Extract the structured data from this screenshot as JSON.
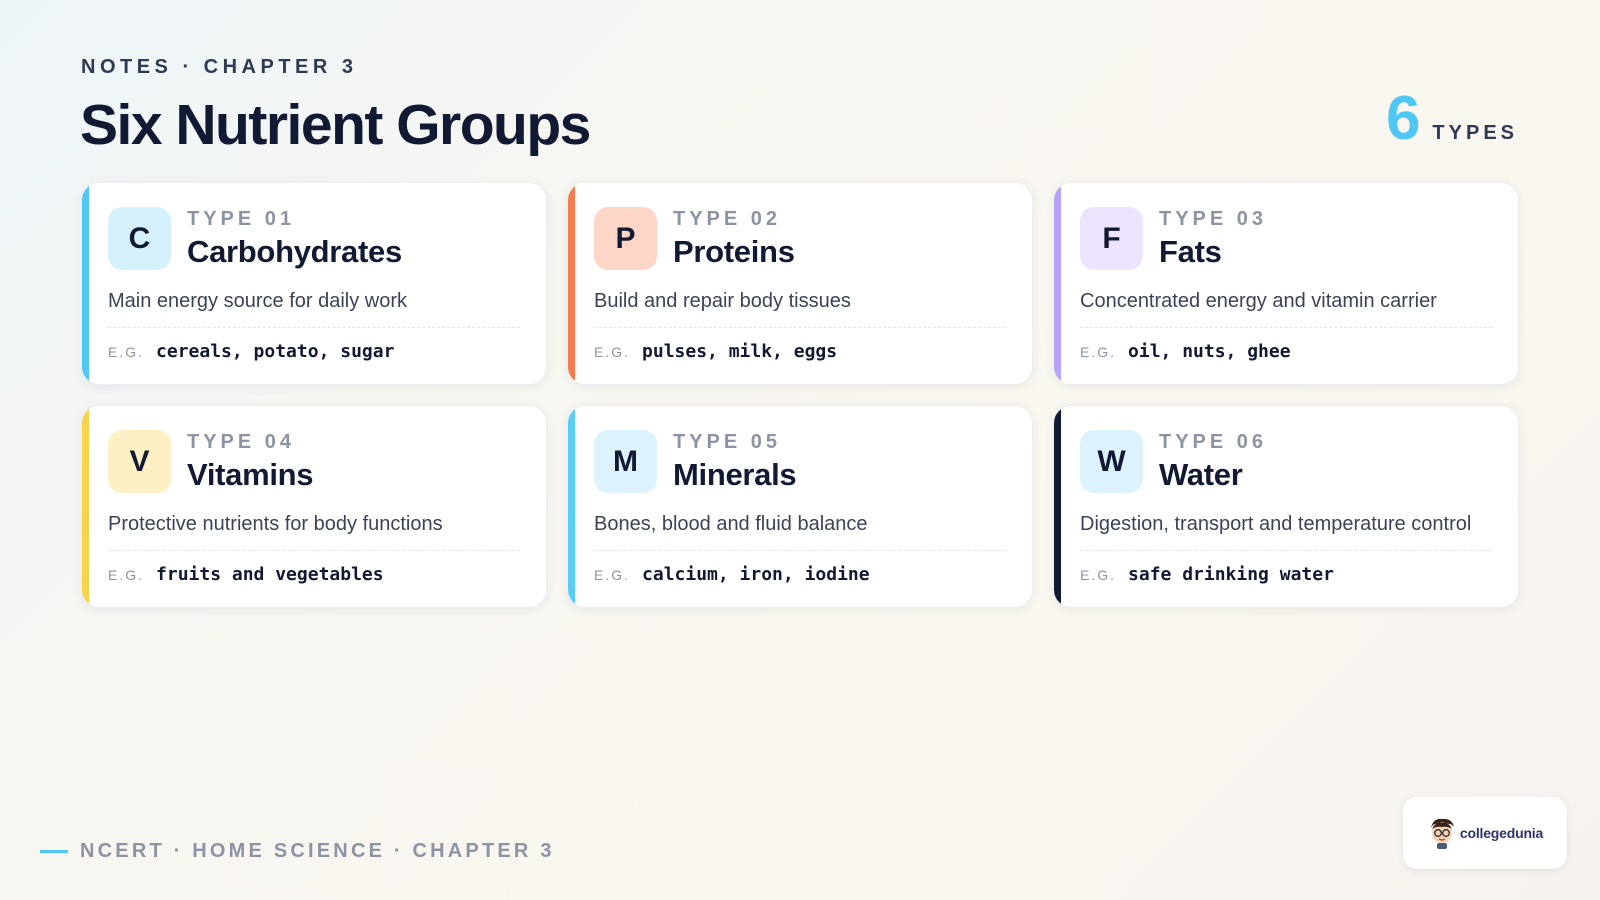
{
  "header": {
    "eyebrow": "NOTES · CHAPTER 3",
    "title": "Six Nutrient Groups",
    "count": "6",
    "count_label": "TYPES"
  },
  "colors": {
    "accent_cyan": "#4fc7f2",
    "accent_orange": "#f47c4f",
    "accent_purple": "#b9a3f6",
    "accent_yellow": "#f7d24a",
    "accent_sky": "#5bcdf5",
    "accent_navy": "#121a33"
  },
  "eg_label": "E.G.",
  "cards": [
    {
      "badge": "C",
      "type": "TYPE 01",
      "name": "Carbohydrates",
      "desc": "Main energy source for daily work",
      "examples": "cereals, potato, sugar",
      "accent": "#4fc7f2",
      "badge_bg": "#d4f1fc"
    },
    {
      "badge": "P",
      "type": "TYPE 02",
      "name": "Proteins",
      "desc": "Build and repair body tissues",
      "examples": "pulses, milk, eggs",
      "accent": "#f47c4f",
      "badge_bg": "#fdd6c7"
    },
    {
      "badge": "F",
      "type": "TYPE 03",
      "name": "Fats",
      "desc": "Concentrated energy and vitamin carrier",
      "examples": "oil, nuts, ghee",
      "accent": "#b9a3f6",
      "badge_bg": "#ece4fd"
    },
    {
      "badge": "V",
      "type": "TYPE 04",
      "name": "Vitamins",
      "desc": "Protective nutrients for body functions",
      "examples": "fruits and vegetables",
      "accent": "#f7d24a",
      "badge_bg": "#fdf0c4"
    },
    {
      "badge": "M",
      "type": "TYPE 05",
      "name": "Minerals",
      "desc": "Bones, blood and fluid balance",
      "examples": "calcium, iron, iodine",
      "accent": "#5bcdf5",
      "badge_bg": "#dcf2fc"
    },
    {
      "badge": "W",
      "type": "TYPE 06",
      "name": "Water",
      "desc": "Digestion, transport and temperature control",
      "examples": "safe drinking water",
      "accent": "#121a33",
      "badge_bg": "#dcf2fc"
    }
  ],
  "footer": {
    "text": "NCERT · HOME SCIENCE · CHAPTER 3"
  },
  "logo": {
    "text": "collegedunia"
  }
}
